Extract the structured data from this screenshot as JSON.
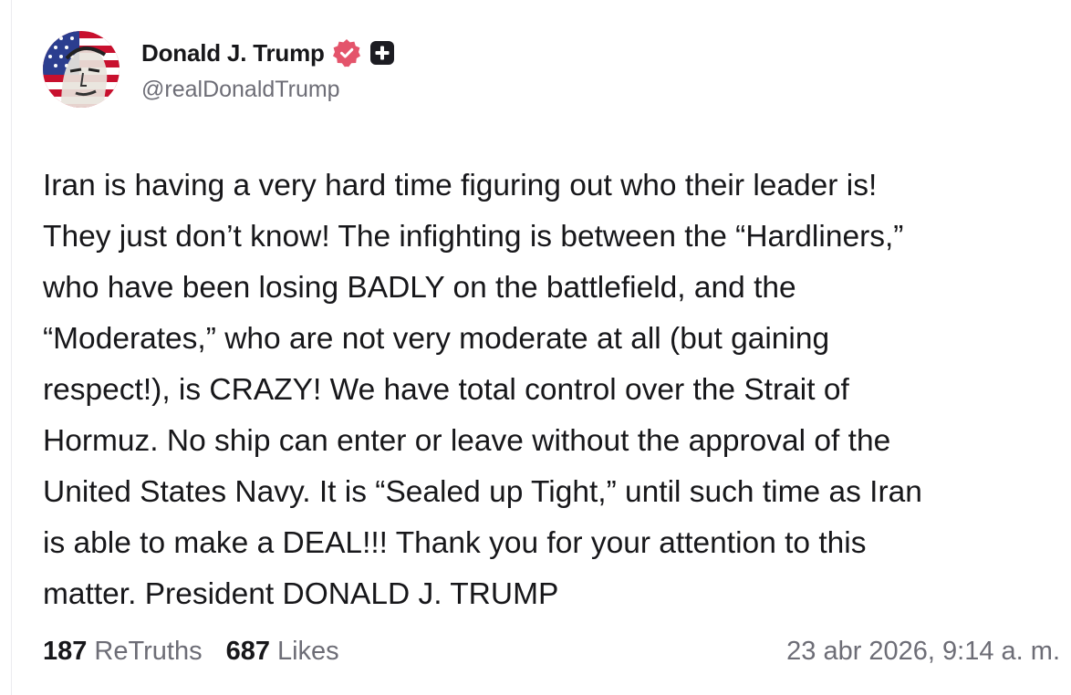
{
  "colors": {
    "verified_badge": "#e4546b",
    "text_primary": "#17171a",
    "text_secondary": "#6d6d76"
  },
  "post": {
    "author": {
      "display_name": "Donald J. Trump",
      "handle": "@realDonaldTrump",
      "verified_icon": "verified-badge-icon",
      "plus_icon": "plus-icon"
    },
    "text": "Iran is having a very hard time figuring out who their leader is!\nThey just don’t know! The infighting is between the “Hardliners,”\nwho have been losing BADLY on the battlefield, and the\n“Moderates,” who are not very moderate at all (but gaining\nrespect!), is CRAZY! We have total control over the Strait of\nHormuz. No ship can enter or leave without the approval of the\nUnited States Navy. It is “Sealed up Tight,” until such time as Iran\nis able to make a DEAL!!! Thank you for your attention to this\nmatter. President DONALD J. TRUMP",
    "stats": {
      "retruths_count": "187",
      "retruths_label": "ReTruths",
      "likes_count": "687",
      "likes_label": "Likes"
    },
    "timestamp": "23 abr 2026, 9:14 a. m."
  }
}
